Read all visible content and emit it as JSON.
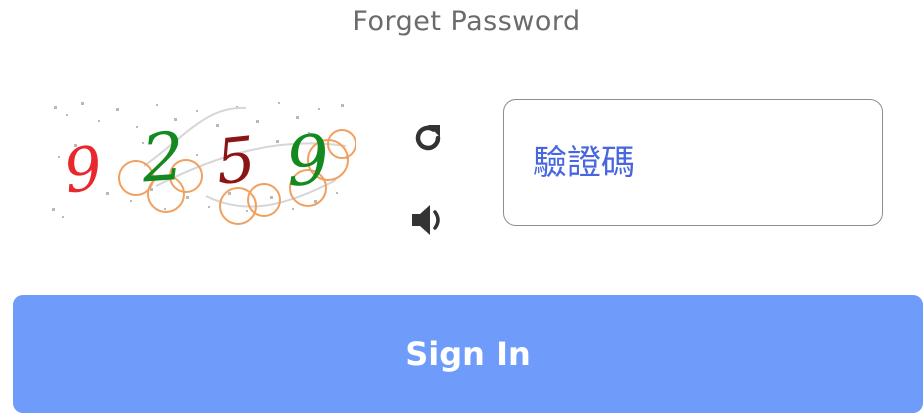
{
  "forget_password": {
    "label": "Forget Password"
  },
  "captcha": {
    "digits": [
      "9",
      "2",
      "5",
      "9"
    ],
    "digit_colors": [
      "#e8282c",
      "#138a1f",
      "#8b1414",
      "#138a1f"
    ]
  },
  "controls": {
    "refresh_icon": "refresh-icon",
    "audio_icon": "speaker-icon"
  },
  "verification": {
    "placeholder": "驗證碼",
    "value": ""
  },
  "signin_button": {
    "label": "Sign In",
    "color": "#6f9cfb"
  }
}
